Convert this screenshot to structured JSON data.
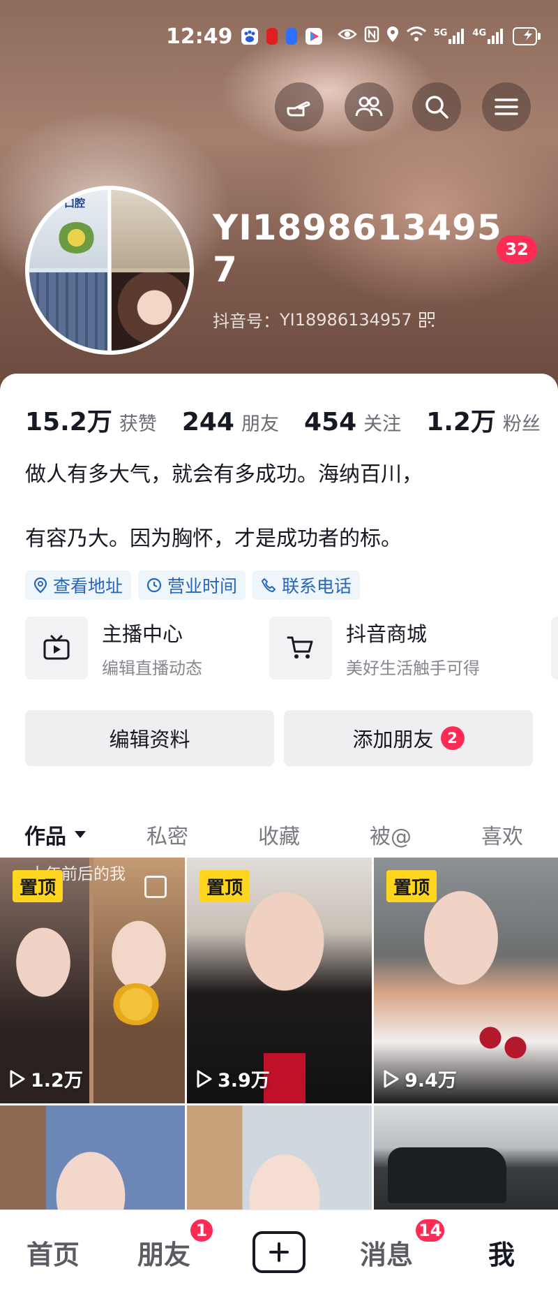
{
  "status_bar": {
    "time": "12:49",
    "network_1": "5G",
    "network_2": "4G",
    "icons": [
      "baidu-icon",
      "app-icon-red",
      "voice-app-icon",
      "video-app-icon",
      "eye-icon",
      "nfc-icon",
      "location-icon",
      "wifi-icon",
      "signal-icon",
      "battery-charging-icon"
    ]
  },
  "header": {
    "nickname": "YI18986134957",
    "notification_count": "32",
    "douyin_id_label": "抖音号：",
    "douyin_id": "YI18986134957",
    "avatar_sign_text": "口腔",
    "top_buttons": [
      "hand-pointer-icon",
      "friends-icon",
      "search-icon",
      "menu-icon"
    ]
  },
  "stats": [
    {
      "value": "15.2万",
      "label": "获赞"
    },
    {
      "value": "244",
      "label": "朋友"
    },
    {
      "value": "454",
      "label": "关注"
    },
    {
      "value": "1.2万",
      "label": "粉丝"
    }
  ],
  "bio": {
    "line1": "做人有多大气，就会有多成功。海纳百川，",
    "line2": "有容乃大。因为胸怀，才是成功者的标。"
  },
  "tags": [
    {
      "icon": "location-pin-icon",
      "label": "查看地址"
    },
    {
      "icon": "clock-icon",
      "label": "营业时间"
    },
    {
      "icon": "phone-icon",
      "label": "联系电话"
    }
  ],
  "services": [
    {
      "icon": "tv-icon",
      "title": "主播中心",
      "subtitle": "编辑直播动态"
    },
    {
      "icon": "cart-icon",
      "title": "抖音商城",
      "subtitle": "美好生活触手可得"
    }
  ],
  "actions": {
    "edit_profile": "编辑资料",
    "add_friends": "添加朋友",
    "add_friends_badge": "2"
  },
  "tabs": [
    {
      "label": "作品",
      "active": true
    },
    {
      "label": "私密",
      "active": false
    },
    {
      "label": "收藏",
      "active": false
    },
    {
      "label": "被@",
      "active": false
    },
    {
      "label": "喜欢",
      "active": false
    }
  ],
  "videos": [
    {
      "pinned": "置顶",
      "plays": "1.2万",
      "overlay": "十年前后的我"
    },
    {
      "pinned": "置顶",
      "plays": "3.9万"
    },
    {
      "pinned": "置顶",
      "plays": "9.4万"
    },
    {},
    {},
    {}
  ],
  "bottom_nav": {
    "home": "首页",
    "friends": "朋友",
    "friends_badge": "1",
    "messages": "消息",
    "messages_badge": "14",
    "me": "我"
  },
  "colors": {
    "accent": "#fe2c55",
    "pin": "#ffd51f",
    "tag_text": "#2766b8"
  }
}
